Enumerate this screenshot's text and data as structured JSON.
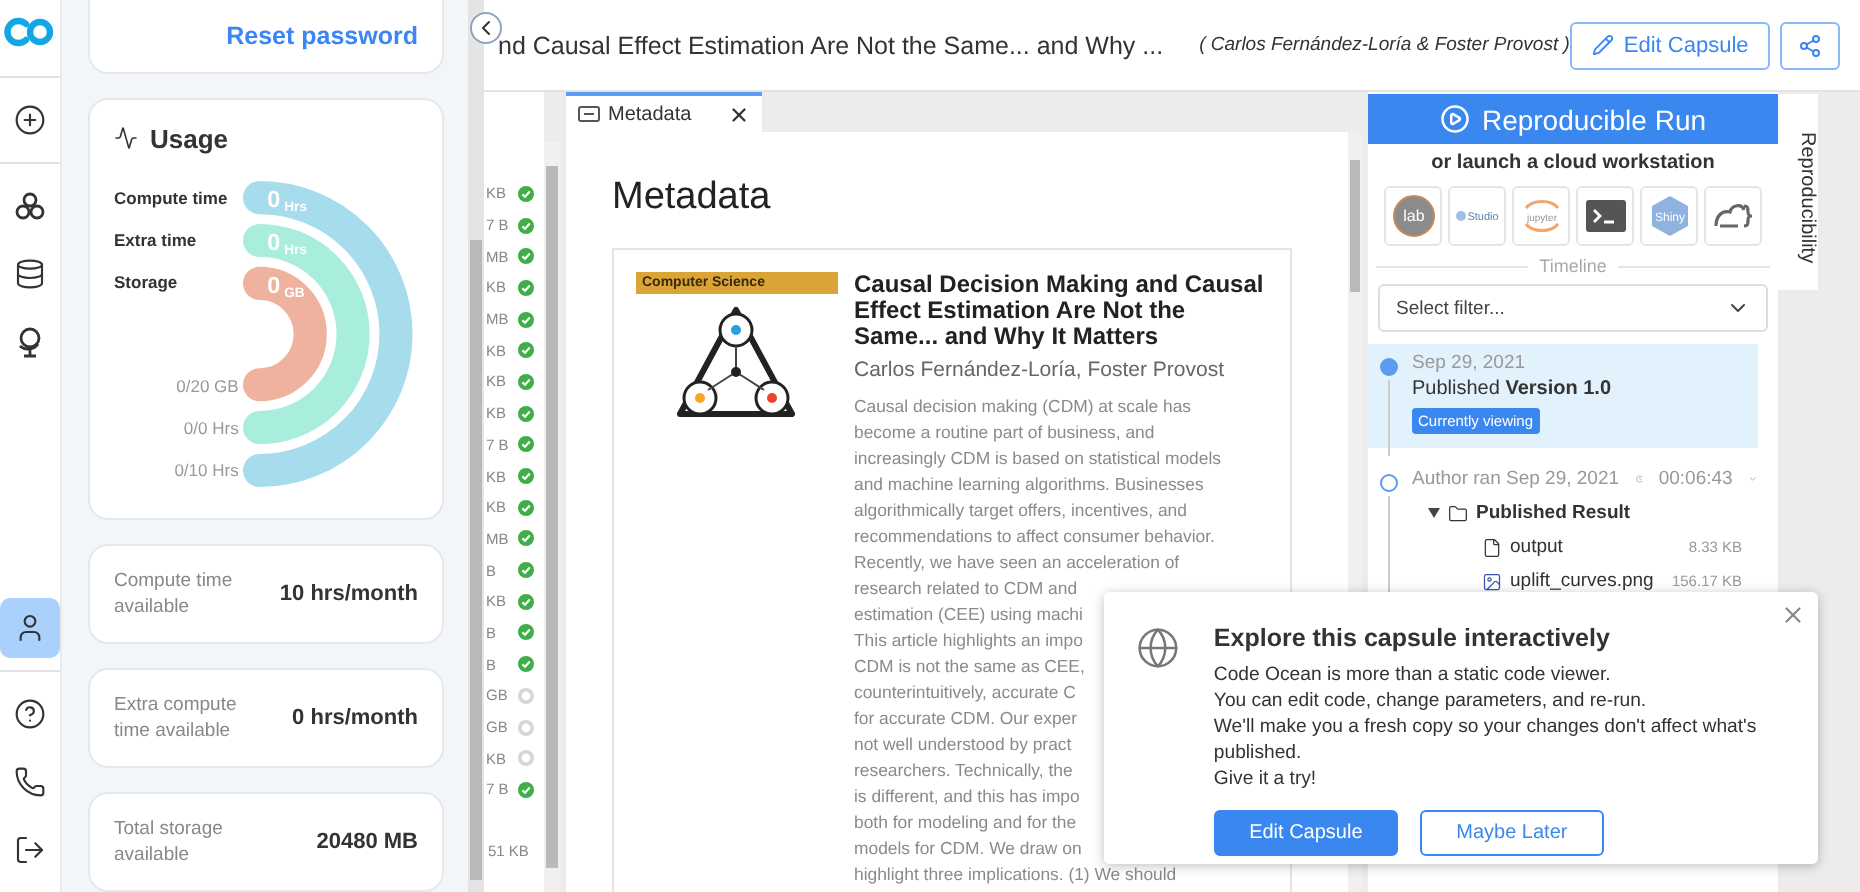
{
  "nav": {
    "top": [
      {
        "kind": "add",
        "selected": false
      },
      {
        "kind": "capsules",
        "selected": false
      },
      {
        "kind": "datasets",
        "selected": false
      },
      {
        "kind": "explore",
        "selected": false
      }
    ],
    "bottom": [
      {
        "kind": "account",
        "selected": true
      },
      {
        "kind": "help",
        "selected": false
      },
      {
        "kind": "contact",
        "selected": false
      },
      {
        "kind": "logout",
        "selected": false
      }
    ]
  },
  "account": {
    "reset_link": "Reset password",
    "usage": {
      "title": "Usage",
      "meters": [
        {
          "label": "Compute time",
          "value": "0",
          "unit": "Hrs",
          "color": "#a6dcec"
        },
        {
          "label": "Extra time",
          "value": "0",
          "unit": "Hrs",
          "color": "#a9eedc"
        },
        {
          "label": "Storage",
          "value": "0",
          "unit": "GB",
          "color": "#efb29f"
        }
      ],
      "totals": [
        "0/20 GB",
        "0/0 Hrs",
        "0/10 Hrs"
      ]
    },
    "stats": [
      {
        "label": "Compute time available",
        "value": "10 hrs/month"
      },
      {
        "label": "Extra compute time available",
        "value": "0 hrs/month"
      },
      {
        "label": "Total storage available",
        "value": "20480 MB"
      }
    ]
  },
  "header": {
    "title": "nd Causal Effect Estimation Are Not the Same... and Why ...",
    "authors": "( Carlos Fernández-Loría & Foster Provost )",
    "edit_button": "Edit Capsule"
  },
  "files": {
    "rows": [
      {
        "size": "KB",
        "done": true
      },
      {
        "size": "7 B",
        "done": true
      },
      {
        "size": "MB",
        "done": true
      },
      {
        "size": "KB",
        "done": true
      },
      {
        "size": "MB",
        "done": true
      },
      {
        "size": "KB",
        "done": true
      },
      {
        "size": "KB",
        "done": true
      },
      {
        "size": "KB",
        "done": true
      },
      {
        "size": "7 B",
        "done": true
      },
      {
        "size": "KB",
        "done": true
      },
      {
        "size": "KB",
        "done": true
      },
      {
        "size": "MB",
        "done": true
      },
      {
        "size": "B",
        "done": true
      },
      {
        "size": "KB",
        "done": true
      },
      {
        "size": "B",
        "done": true
      },
      {
        "size": "B",
        "done": true
      },
      {
        "size": "GB",
        "done": false
      },
      {
        "size": "GB",
        "done": false
      },
      {
        "size": "KB",
        "done": false
      },
      {
        "size": "7 B",
        "done": true
      }
    ],
    "total": "51 KB"
  },
  "metadata": {
    "tab": {
      "label": "Metadata",
      "selected": true
    },
    "heading": "Metadata",
    "card": {
      "category": "Computer Science",
      "title": "Causal Decision Making and Causal Effect Estimation Are Not the Same... and Why It Matters",
      "authors": "Carlos Fernández-Loría, Foster Provost",
      "abstract_lines": [
        "Causal decision making (CDM) at scale has",
        "become a routine part of business, and",
        "increasingly CDM is based on statistical models",
        "and machine learning algorithms. Businesses",
        "algorithmically target offers, incentives, and",
        "recommendations to affect consumer behavior.",
        "Recently, we have seen an acceleration of",
        "research related to CDM and",
        "estimation (CEE) using machi",
        "This article highlights an impo",
        "CDM is not the same as CEE,",
        "counterintuitively, accurate C",
        "for accurate CDM. Our exper",
        "not well understood by pract",
        "researchers. Technically, the",
        "is different, and this has impo",
        "both for modeling and for the",
        "models for CDM. We draw on",
        "highlight three implications. (1) We should"
      ]
    }
  },
  "run": {
    "button": "Reproducible Run",
    "subtitle": "or launch a cloud workstation",
    "workstations": [
      {
        "kind": "lab",
        "label": "lab"
      },
      {
        "kind": "rstudio",
        "label": "Studio"
      },
      {
        "kind": "jupyter",
        "label": "jupyter"
      },
      {
        "kind": "terminal"
      },
      {
        "kind": "shiny",
        "label": "Shiny"
      },
      {
        "kind": "vscode"
      }
    ],
    "timeline": {
      "label": "Timeline",
      "filter": {
        "placeholder": "Select filter..."
      },
      "entries": [
        {
          "kind": "publish",
          "selected": true,
          "date": "Sep 29, 2021",
          "text": "Published **Version 1.0**",
          "badge": "Currently viewing"
        },
        {
          "kind": "run",
          "selected": false,
          "text": "Author ran Sep 29, 2021",
          "duration": "00:06:43",
          "expanded": true,
          "results": {
            "name": "Published Result",
            "expanded": true,
            "children": [
              {
                "kind": "file",
                "name": "output",
                "size": "8.33 KB"
              },
              {
                "kind": "image",
                "name": "uplift_curves.png",
                "size": "156.17 KB"
              }
            ]
          }
        }
      ]
    }
  },
  "side_tab": {
    "label": "Reproducibility",
    "selected": true
  },
  "popup": {
    "title": "Explore this capsule interactively",
    "lines": [
      "Code Ocean is more than a static code viewer.",
      "You can edit code, change parameters, and re-run.",
      "We'll make you a fresh copy so your changes don't affect what's published.",
      "Give it a try!"
    ],
    "primary": "Edit Capsule",
    "secondary": "Maybe Later"
  }
}
